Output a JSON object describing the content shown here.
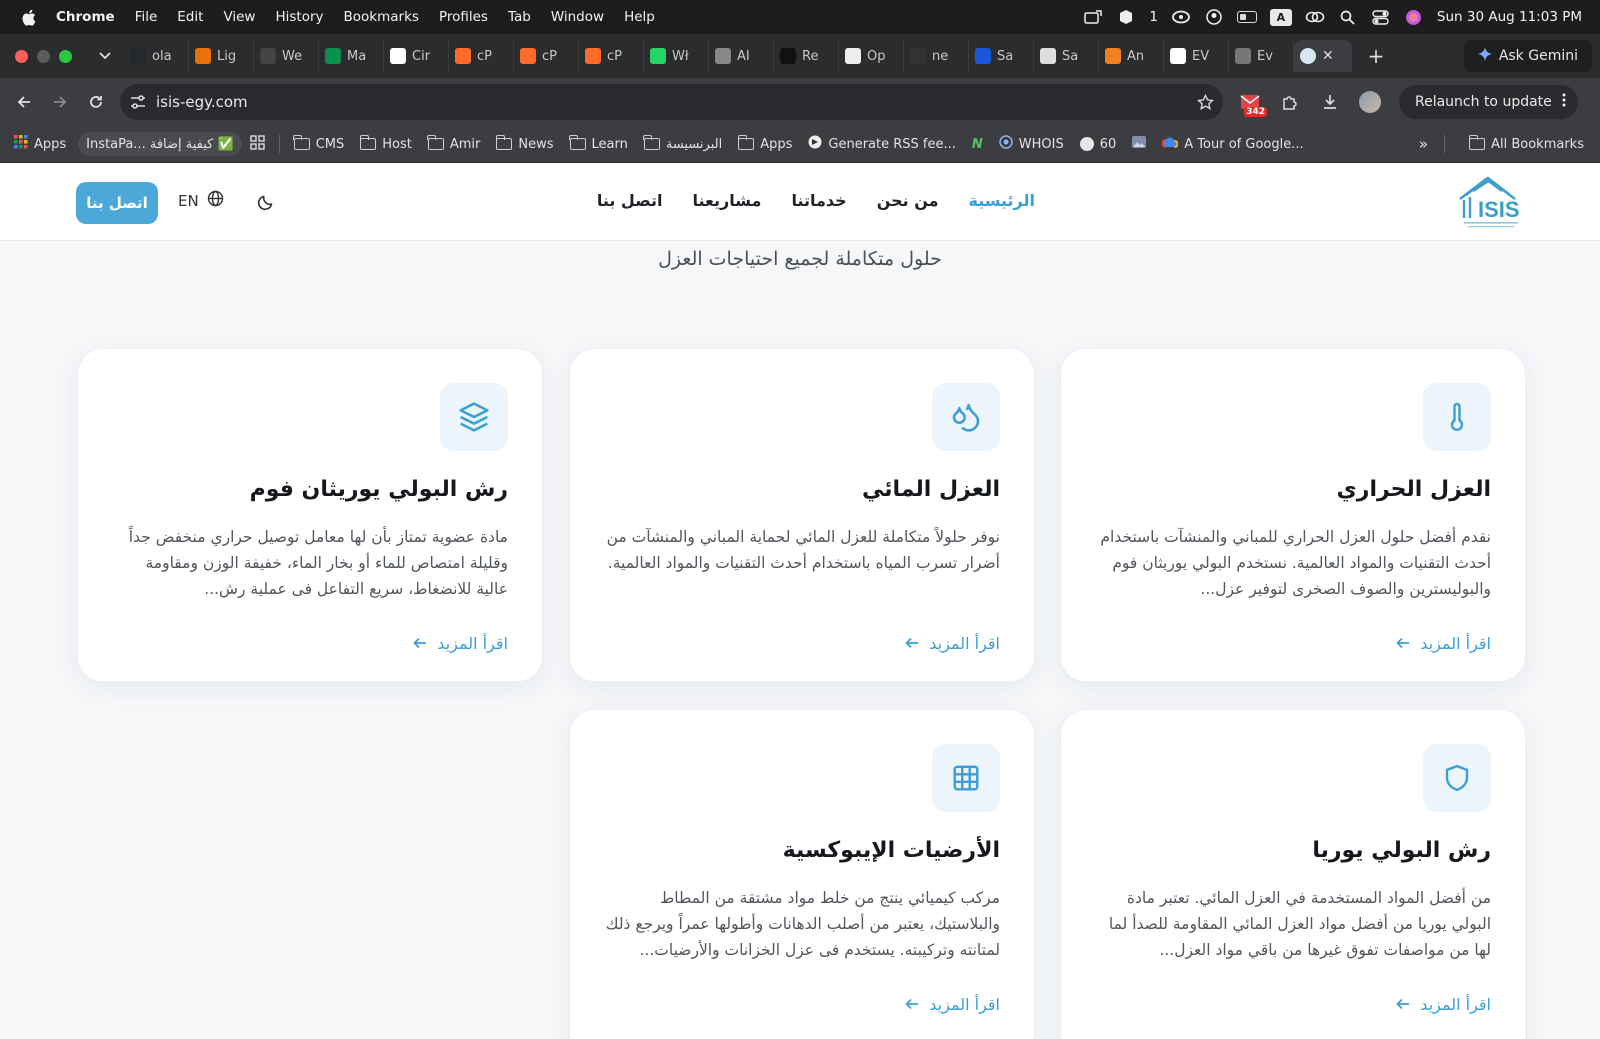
{
  "menubar": {
    "app": "Chrome",
    "items": [
      "File",
      "Edit",
      "View",
      "History",
      "Bookmarks",
      "Profiles",
      "Tab",
      "Window",
      "Help"
    ],
    "status_count": "1",
    "input_letter": "A",
    "clock": "Sun 30 Aug  11:03 PM"
  },
  "tabs": [
    {
      "label": "ola",
      "color": "#24292f",
      "icon": "github-icon"
    },
    {
      "label": "Lig",
      "color": "#e8710a",
      "icon": "lighthouse-icon"
    },
    {
      "label": "We",
      "color": "#444444",
      "icon": "web-icon"
    },
    {
      "label": "Ma",
      "color": "#0b8f4f",
      "icon": "h-icon"
    },
    {
      "label": "Cir",
      "color": "#ffffff",
      "icon": "circle-icon"
    },
    {
      "label": "cP",
      "color": "#ff6c2c",
      "icon": "cpanel-icon"
    },
    {
      "label": "cP",
      "color": "#ff6c2c",
      "icon": "cpanel-icon"
    },
    {
      "label": "cP",
      "color": "#ff6c2c",
      "icon": "cpanel-icon"
    },
    {
      "label": "Wł",
      "color": "#25d366",
      "icon": "whatsapp-icon"
    },
    {
      "label": "AI",
      "color": "#888888",
      "icon": "ai-icon"
    },
    {
      "label": "Re",
      "color": "#111111",
      "icon": "re-icon"
    },
    {
      "label": "Op",
      "color": "#eeeeee",
      "icon": "openai-icon"
    },
    {
      "label": "ne",
      "color": "#333333",
      "icon": "github-icon"
    },
    {
      "label": "Sa",
      "color": "#1a56db",
      "icon": "sa-icon"
    },
    {
      "label": "Sa",
      "color": "#dddddd",
      "icon": "sa-icon"
    },
    {
      "label": "An",
      "color": "#f38020",
      "icon": "an-icon"
    },
    {
      "label": "EV",
      "color": "#ffffff",
      "icon": "ev-icon"
    },
    {
      "label": "Ev",
      "color": "#777777",
      "icon": "ev-icon"
    }
  ],
  "gemini_label": "Ask Gemini",
  "url": "isis-egy.com",
  "extension_badge": "342",
  "relaunch_label": "Relaunch to update",
  "bookmarks": {
    "apps": "Apps",
    "instapaper": "InstaPa... كيفية إضافة ✅",
    "folders": [
      "CMS",
      "Host",
      "Amir",
      "News",
      "Learn",
      "البرنسيسة",
      "Apps"
    ],
    "generate": "Generate RSS fee...",
    "whois": "WHOIS",
    "sixty": "60",
    "tour": "A Tour of Google...",
    "all": "All Bookmarks"
  },
  "site": {
    "nav": [
      "الرئيسية",
      "من نحن",
      "خدماتنا",
      "مشاريعنا",
      "اتصل بنا"
    ],
    "lang": "EN",
    "contact_button": "اتصل بنا",
    "subtitle": "حلول متكاملة لجميع احتياجات العزل",
    "accent": "#3b9ed6",
    "cards": [
      {
        "title": "العزل الحراري",
        "desc": "نقدم أفضل حلول العزل الحراري للمباني والمنشآت باستخدام أحدث التقنيات والمواد العالمية. نستخدم البولي يوريثان فوم والبوليسترين والصوف الصخرى لتوفير عزل...",
        "more": "اقرأ المزيد",
        "icon": "thermometer-icon"
      },
      {
        "title": "العزل المائي",
        "desc": "نوفر حلولاً متكاملة للعزل المائي لحماية المباني والمنشآت من أضرار تسرب المياه باستخدام أحدث التقنيات والمواد العالمية.",
        "more": "اقرأ المزيد",
        "icon": "droplets-icon"
      },
      {
        "title": "رش البولي يوريثان فوم",
        "desc": "مادة عضوية تمتاز بأن لها معامل توصيل حراري منخفض جداً وقليلة امتصاص للماء أو بخار الماء، خفيفة الوزن ومقاومة عالية للانضغاط، سريع التفاعل فى عملية رش...",
        "more": "اقرأ المزيد",
        "icon": "layers-icon"
      },
      {
        "title": "رش البولي يوريا",
        "desc": "من أفضل المواد المستخدمة في العزل المائي. تعتبر مادة البولي يوريا من أفضل مواد العزل المائي المقاومة للصدأ لما لها من مواصفات تفوق غيرها من باقي مواد العزل...",
        "more": "اقرأ المزيد",
        "icon": "shield-icon"
      },
      {
        "title": "الأرضيات الإيبوكسية",
        "desc": "مركب كيميائي ينتج من خلط مواد مشتقة من المطاط والبلاستيك، يعتبر من أصلب الدهانات وأطولها عمراً ويرجع ذلك لمتانته وتركيبته. يستخدم فى عزل الخزانات والأرضيات...",
        "more": "اقرأ المزيد",
        "icon": "grid-icon"
      }
    ]
  }
}
